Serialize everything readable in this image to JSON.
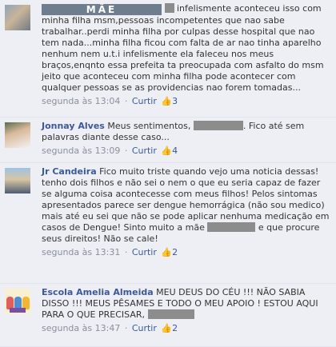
{
  "comments": [
    {
      "author": "",
      "name_overlay": "MÃE",
      "text": "infelismente aconteceu isso com minha filha msm,pessoas incompetentes que nao sabe trabalhar..perdi minha filha por culpas desse hospital que nao tem nada...minha filha ficou com falta de ar nao tinha aparelho nenhum nem u.t.i infelismente ela faleceu nos meus braços,enqnto essa prefeita ta preocupada com asfalto do msm jeito que aconteceu com minha filha pode acontecer com qualquer pessoas se as providencias nao forem tomadas...",
      "time": "segunda às 13:04",
      "reply": "Curtir",
      "likes": "3",
      "avatar": "user-photo-1"
    },
    {
      "author": "Jonnay Alves",
      "text_before": "Meus sentimentos,",
      "text_after": ". Fico até sem palavras diante desse caso...",
      "time": "segunda às 13:09",
      "reply": "Curtir",
      "likes": "4",
      "avatar": "user-photo-2"
    },
    {
      "author": "Jr Candeira",
      "text_before": "Fico muito triste quando vejo uma noticia dessas! tenho dois filhos e não sei o nem o que eu seria capaz de fazer se alguma coisa acontecesse com meus filhos! Pelos sintomas apresentados parece ser dengue hemorrágica (não sou medico) mais até eu sei que não se pode aplicar nenhuma medicação em casos de Dengue! Sinto muito a mãe",
      "text_after": "e que procure seus direitos! Não se cale!",
      "time": "segunda às 13:31",
      "reply": "Curtir",
      "likes": "2",
      "avatar": "user-photo-3"
    },
    {
      "author": "Escola Amelia Almeida",
      "text_before": "MEU DEUS DO CÉU !!! NÃO SABIA DISSO !!! MEUS PÊSAMES E TODO O MEU APOIO ! ESTOU AQUI PARA O QUE PRECISAR,",
      "time": "segunda às 13:47",
      "reply": "Curtir",
      "likes": "2",
      "avatar": "school-logo"
    }
  ],
  "separator": "·",
  "colors": {
    "background": "#edeff4",
    "link": "#3b5998",
    "meta": "#898f9c",
    "redaction": "#8c8c8c"
  }
}
